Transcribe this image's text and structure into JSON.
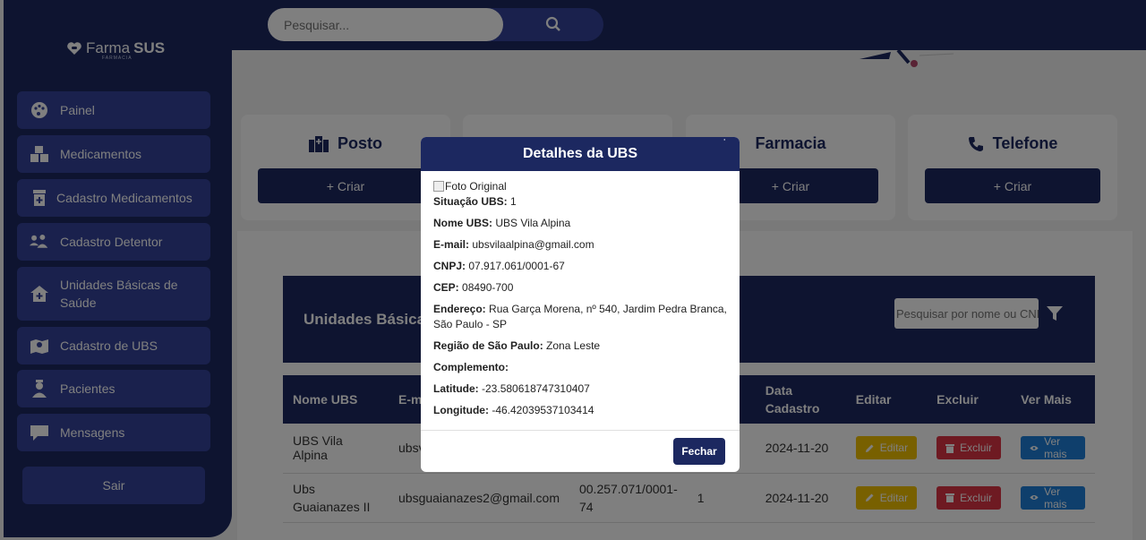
{
  "app": {
    "logo_main": "Farma",
    "logo_bold": "SUS",
    "logo_sub": "FARMACIA"
  },
  "sidebar": {
    "items": [
      {
        "label": "Painel",
        "icon": "palette-icon"
      },
      {
        "label": "Medicamentos",
        "icon": "boxes-icon"
      },
      {
        "label": "Cadastro Medicamentos",
        "icon": "medicine-box-icon"
      },
      {
        "label": "Cadastro Detentor",
        "icon": "users-icon"
      },
      {
        "label": "Unidades Básicas de Saúde",
        "icon": "clinic-icon"
      },
      {
        "label": "Cadastro de UBS",
        "icon": "map-location-icon"
      },
      {
        "label": "Pacientes",
        "icon": "patient-icon"
      },
      {
        "label": "Mensagens",
        "icon": "chat-icon"
      }
    ],
    "logout_label": "Sair"
  },
  "search": {
    "placeholder": "Pesquisar..."
  },
  "cards": [
    {
      "title": "Posto",
      "button": "+ Criar"
    },
    {
      "title": "",
      "button": ""
    },
    {
      "title": "Farmacia",
      "button": "+ Criar"
    },
    {
      "title": "Telefone",
      "button": "+ Criar"
    }
  ],
  "table_section": {
    "title": "Unidades Básicas",
    "filter_placeholder": "Pesquisar por nome ou CNPJ",
    "headers": [
      "Nome UBS",
      "E-m",
      "",
      "",
      "Data Cadastro",
      "Editar",
      "Excluir",
      "Ver Mais"
    ],
    "rows": [
      {
        "nome": "UBS Vila Alpina",
        "email": "ubsv",
        "cnpj": "",
        "situacao": "",
        "data": "2024-11-20"
      },
      {
        "nome": "Ubs Guaianazes II",
        "email": "ubsguaianazes2@gmail.com",
        "cnpj": "00.257.071/0001-74",
        "situacao": "1",
        "data": "2024-11-20"
      }
    ],
    "edit_label": "Editar",
    "delete_label": "Excluir",
    "view_label": "Ver mais"
  },
  "modal": {
    "title": "Detalhes da UBS",
    "close_symbol": "˙",
    "photo_alt": "Foto Original",
    "fields": [
      {
        "label": "Situação UBS:",
        "value": "1"
      },
      {
        "label": "Nome UBS:",
        "value": "UBS Vila Alpina"
      },
      {
        "label": "E-mail:",
        "value": "ubsvilaalpina@gmail.com"
      },
      {
        "label": "CNPJ:",
        "value": "07.917.061/0001-67"
      },
      {
        "label": "CEP:",
        "value": "08490-700"
      },
      {
        "label": "Endereço:",
        "value": "Rua Garça Morena, nº 540, Jardim Pedra Branca, São Paulo - SP"
      },
      {
        "label": "Região de São Paulo:",
        "value": "Zona Leste"
      },
      {
        "label": "Complemento:",
        "value": ""
      },
      {
        "label": "Latitude:",
        "value": "-23.580618747310407"
      },
      {
        "label": "Longitude:",
        "value": "-46.42039537103414"
      }
    ],
    "close_button": "Fechar"
  },
  "colors": {
    "navy": "#1c2860",
    "nav_item": "#34439a",
    "edit": "#f0c000",
    "delete": "#dc3545",
    "view": "#1e7fd8"
  }
}
